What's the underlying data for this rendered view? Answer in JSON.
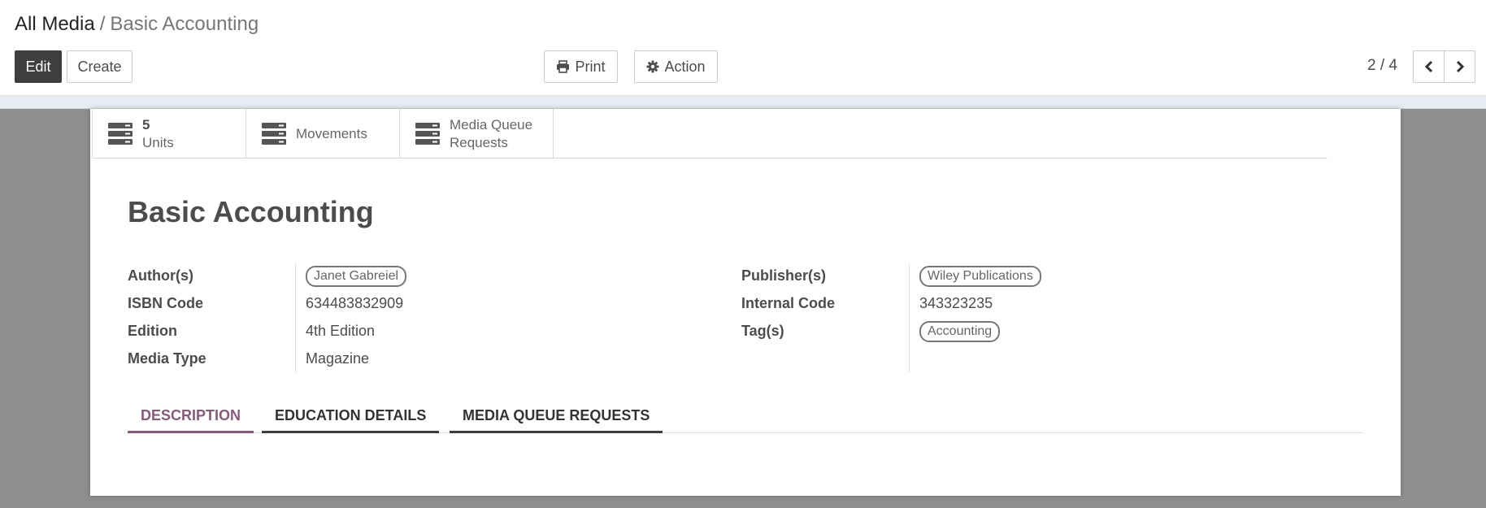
{
  "breadcrumb": {
    "parent": "All Media",
    "separator": "/",
    "current": "Basic Accounting"
  },
  "toolbar": {
    "edit_label": "Edit",
    "create_label": "Create",
    "print_label": "Print",
    "action_label": "Action",
    "pager": "2 / 4"
  },
  "smart_buttons": [
    {
      "value": "5",
      "label": "Units",
      "icon": "server-icon"
    },
    {
      "label": "Movements",
      "icon": "server-icon"
    },
    {
      "label_line1": "Media Queue",
      "label_line2": "Requests",
      "icon": "server-icon"
    }
  ],
  "record": {
    "title": "Basic Accounting",
    "left_fields": [
      {
        "label": "Author(s)",
        "value": "Janet Gabreiel",
        "tag": true
      },
      {
        "label": "ISBN Code",
        "value": "634483832909"
      },
      {
        "label": "Edition",
        "value": "4th Edition"
      },
      {
        "label": "Media Type",
        "value": "Magazine"
      }
    ],
    "right_fields": [
      {
        "label": "Publisher(s)",
        "value": "Wiley Publications",
        "tag": true
      },
      {
        "label": "Internal Code",
        "value": "343323235"
      },
      {
        "label": "Tag(s)",
        "value": "Accounting",
        "tag": true
      }
    ]
  },
  "tabs": [
    {
      "label": "DESCRIPTION",
      "active": true
    },
    {
      "label": "EDUCATION DETAILS"
    },
    {
      "label": "MEDIA QUEUE REQUESTS"
    }
  ],
  "colors": {
    "accent": "#875a7b",
    "primary_button": "#3e3e3e",
    "background_gray": "#8f8f8f"
  }
}
